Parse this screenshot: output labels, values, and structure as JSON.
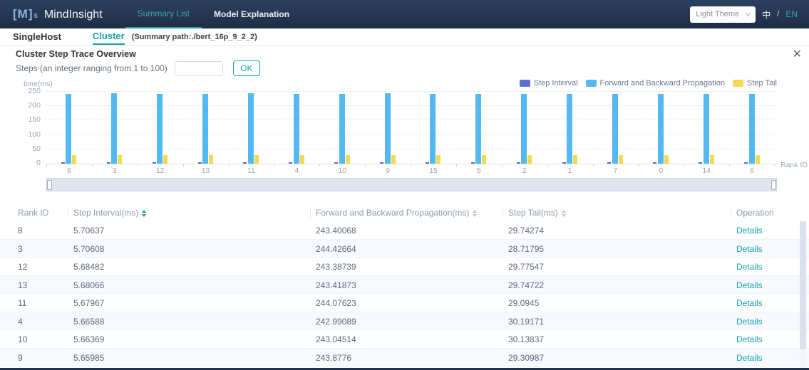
{
  "colors": {
    "teal_accent": "#14a3a9",
    "navbar_bg": "#243350",
    "datazoom_fill": "#dfe5ef",
    "row_alt_bg": "#f6f9fd"
  },
  "icons": {
    "close": "✕",
    "chevron_down": "∨"
  },
  "navbar": {
    "logo_bracket": "[M]",
    "logo_sup": "S",
    "logo_text": "MindInsight",
    "tabs": [
      {
        "label": "Summary List",
        "active": true
      },
      {
        "label": "Model Explanation",
        "active": false
      }
    ],
    "theme_select_value": "Light Theme",
    "lang_zh": "中",
    "lang_divider": "/",
    "lang_en": "EN"
  },
  "subnav": {
    "tabs": [
      {
        "label": "SingleHost",
        "active": false
      },
      {
        "label": "Cluster",
        "active": true
      }
    ],
    "summary_path": "(Summary path:./bert_16p_9_2_2)"
  },
  "panel": {
    "title": "Cluster Step Trace Overview",
    "steps_label": "Steps (an integer ranging from 1 to 100)",
    "steps_input_value": "",
    "ok_label": "OK"
  },
  "chart_data": {
    "type": "bar",
    "title": "",
    "ylabel": "time(ms)",
    "xlabel": "Rank ID",
    "ylim": [
      0,
      250
    ],
    "yticks": [
      0,
      50,
      100,
      150,
      200,
      250
    ],
    "grid": true,
    "legend_position": "top-right",
    "categories": [
      "8",
      "3",
      "12",
      "13",
      "11",
      "4",
      "10",
      "9",
      "15",
      "5",
      "2",
      "1",
      "7",
      "0",
      "14",
      "6"
    ],
    "series": [
      {
        "name": "Step Interval",
        "color": "#5b6fd0",
        "values": [
          5.70637,
          5.70608,
          5.68482,
          5.68066,
          5.67967,
          5.66588,
          5.66369,
          5.65985,
          5.65,
          5.64,
          5.64,
          5.63,
          5.63,
          5.62,
          5.62,
          5.61
        ]
      },
      {
        "name": "Forward and Backward Propagation",
        "color": "#54b9f2",
        "values": [
          243.40068,
          244.42664,
          243.38739,
          243.41873,
          244.07623,
          242.99089,
          243.04514,
          243.8776,
          243.5,
          243.5,
          243.5,
          243.5,
          243.5,
          243.5,
          243.5,
          243.5
        ]
      },
      {
        "name": "Step Tail",
        "color": "#f5d951",
        "values": [
          29.74274,
          28.71795,
          29.77547,
          29.74722,
          29.0945,
          30.19171,
          30.13837,
          29.30987,
          29.5,
          29.5,
          29.5,
          29.5,
          29.5,
          29.5,
          29.5,
          29.5
        ]
      }
    ]
  },
  "table": {
    "columns": [
      {
        "label": "Rank ID",
        "sortable": false,
        "sort_active": false
      },
      {
        "label": "Step Interval(ms)",
        "sortable": true,
        "sort_active": true
      },
      {
        "label": "Forward and Backward Propagation(ms)",
        "sortable": true,
        "sort_active": false
      },
      {
        "label": "Step Tail(ms)",
        "sortable": true,
        "sort_active": false
      },
      {
        "label": "Operation",
        "sortable": false,
        "sort_active": false
      }
    ],
    "rows": [
      [
        "8",
        "5.70637",
        "243.40068",
        "29.74274",
        "Details"
      ],
      [
        "3",
        "5.70608",
        "244.42664",
        "28.71795",
        "Details"
      ],
      [
        "12",
        "5.68482",
        "243.38739",
        "29.77547",
        "Details"
      ],
      [
        "13",
        "5.68066",
        "243.41873",
        "29.74722",
        "Details"
      ],
      [
        "11",
        "5.67967",
        "244.07623",
        "29.0945",
        "Details"
      ],
      [
        "4",
        "5.66588",
        "242.99089",
        "30.19171",
        "Details"
      ],
      [
        "10",
        "5.66369",
        "243.04514",
        "30.13837",
        "Details"
      ],
      [
        "9",
        "5.65985",
        "243.8776",
        "29.30987",
        "Details"
      ]
    ]
  }
}
